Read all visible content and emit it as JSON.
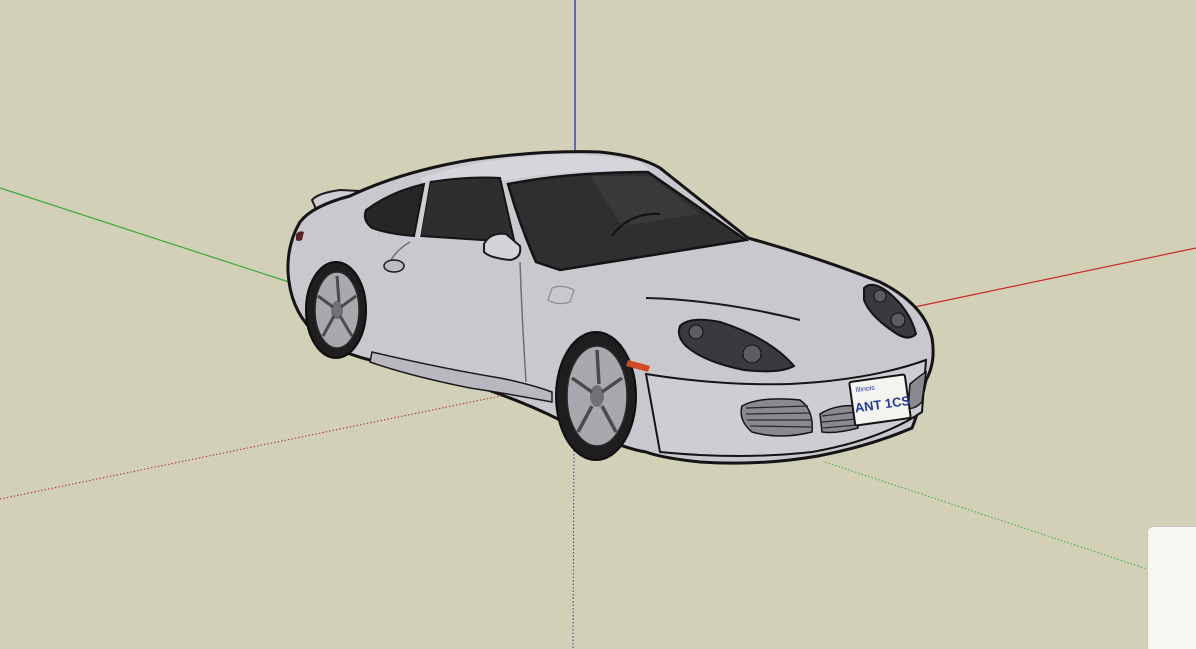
{
  "scene": {
    "background_color": "#d2d0b6",
    "axes": {
      "red_axis_color": "#cc2a2a",
      "green_axis_color": "#3fa83f",
      "blue_axis_color": "#2a2ad0"
    },
    "model": {
      "name": "car-model",
      "body_color": "#c9c8cf",
      "glass_color": "#2b2b2b",
      "license_plate": {
        "state_label": "Illinois",
        "plate_number": "ANT 1CS"
      }
    }
  }
}
